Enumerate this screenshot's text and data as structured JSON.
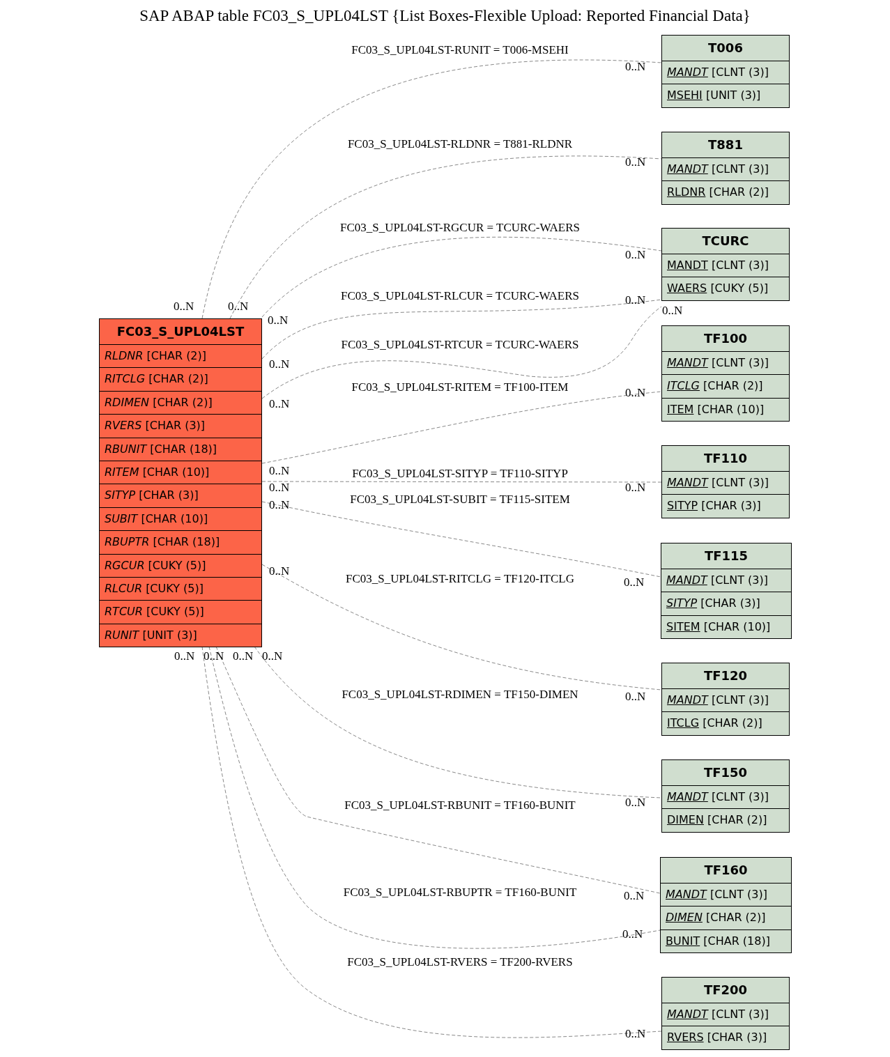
{
  "title": "SAP ABAP table FC03_S_UPL04LST {List Boxes-Flexible Upload: Reported Financial Data}",
  "entities": [
    {
      "name": "FC03_S_UPL04LST",
      "kind": "main",
      "fields": [
        {
          "name": "RLDNR",
          "type": "[CHAR (2)]",
          "italic": true,
          "underline": false
        },
        {
          "name": "RITCLG",
          "type": "[CHAR (2)]",
          "italic": true,
          "underline": false
        },
        {
          "name": "RDIMEN",
          "type": "[CHAR (2)]",
          "italic": true,
          "underline": false
        },
        {
          "name": "RVERS",
          "type": "[CHAR (3)]",
          "italic": true,
          "underline": false
        },
        {
          "name": "RBUNIT",
          "type": "[CHAR (18)]",
          "italic": true,
          "underline": false
        },
        {
          "name": "RITEM",
          "type": "[CHAR (10)]",
          "italic": true,
          "underline": false
        },
        {
          "name": "SITYP",
          "type": "[CHAR (3)]",
          "italic": true,
          "underline": false
        },
        {
          "name": "SUBIT",
          "type": "[CHAR (10)]",
          "italic": true,
          "underline": false
        },
        {
          "name": "RBUPTR",
          "type": "[CHAR (18)]",
          "italic": true,
          "underline": false
        },
        {
          "name": "RGCUR",
          "type": "[CUKY (5)]",
          "italic": true,
          "underline": false
        },
        {
          "name": "RLCUR",
          "type": "[CUKY (5)]",
          "italic": true,
          "underline": false
        },
        {
          "name": "RTCUR",
          "type": "[CUKY (5)]",
          "italic": true,
          "underline": false
        },
        {
          "name": "RUNIT",
          "type": "[UNIT (3)]",
          "italic": true,
          "underline": false
        }
      ]
    },
    {
      "name": "T006",
      "kind": "related",
      "fields": [
        {
          "name": "MANDT",
          "type": "[CLNT (3)]",
          "italic": true,
          "underline": true
        },
        {
          "name": "MSEHI",
          "type": "[UNIT (3)]",
          "italic": false,
          "underline": true
        }
      ]
    },
    {
      "name": "T881",
      "kind": "related",
      "fields": [
        {
          "name": "MANDT",
          "type": "[CLNT (3)]",
          "italic": true,
          "underline": true
        },
        {
          "name": "RLDNR",
          "type": "[CHAR (2)]",
          "italic": false,
          "underline": true
        }
      ]
    },
    {
      "name": "TCURC",
      "kind": "related",
      "fields": [
        {
          "name": "MANDT",
          "type": "[CLNT (3)]",
          "italic": false,
          "underline": true
        },
        {
          "name": "WAERS",
          "type": "[CUKY (5)]",
          "italic": false,
          "underline": true
        }
      ]
    },
    {
      "name": "TF100",
      "kind": "related",
      "fields": [
        {
          "name": "MANDT",
          "type": "[CLNT (3)]",
          "italic": true,
          "underline": true
        },
        {
          "name": "ITCLG",
          "type": "[CHAR (2)]",
          "italic": true,
          "underline": true
        },
        {
          "name": "ITEM",
          "type": "[CHAR (10)]",
          "italic": false,
          "underline": true
        }
      ]
    },
    {
      "name": "TF110",
      "kind": "related",
      "fields": [
        {
          "name": "MANDT",
          "type": "[CLNT (3)]",
          "italic": true,
          "underline": true
        },
        {
          "name": "SITYP",
          "type": "[CHAR (3)]",
          "italic": false,
          "underline": true
        }
      ]
    },
    {
      "name": "TF115",
      "kind": "related",
      "fields": [
        {
          "name": "MANDT",
          "type": "[CLNT (3)]",
          "italic": true,
          "underline": true
        },
        {
          "name": "SITYP",
          "type": "[CHAR (3)]",
          "italic": true,
          "underline": true
        },
        {
          "name": "SITEM",
          "type": "[CHAR (10)]",
          "italic": false,
          "underline": true
        }
      ]
    },
    {
      "name": "TF120",
      "kind": "related",
      "fields": [
        {
          "name": "MANDT",
          "type": "[CLNT (3)]",
          "italic": true,
          "underline": true
        },
        {
          "name": "ITCLG",
          "type": "[CHAR (2)]",
          "italic": false,
          "underline": true
        }
      ]
    },
    {
      "name": "TF150",
      "kind": "related",
      "fields": [
        {
          "name": "MANDT",
          "type": "[CLNT (3)]",
          "italic": true,
          "underline": true
        },
        {
          "name": "DIMEN",
          "type": "[CHAR (2)]",
          "italic": false,
          "underline": true
        }
      ]
    },
    {
      "name": "TF160",
      "kind": "related",
      "fields": [
        {
          "name": "MANDT",
          "type": "[CLNT (3)]",
          "italic": true,
          "underline": true
        },
        {
          "name": "DIMEN",
          "type": "[CHAR (2)]",
          "italic": true,
          "underline": true
        },
        {
          "name": "BUNIT",
          "type": "[CHAR (18)]",
          "italic": false,
          "underline": true
        }
      ]
    },
    {
      "name": "TF200",
      "kind": "related",
      "fields": [
        {
          "name": "MANDT",
          "type": "[CLNT (3)]",
          "italic": true,
          "underline": true
        },
        {
          "name": "RVERS",
          "type": "[CHAR (3)]",
          "italic": false,
          "underline": true
        }
      ]
    }
  ],
  "relations": [
    {
      "label": "FC03_S_UPL04LST-RUNIT = T006-MSEHI",
      "source_cardinality": "0..N",
      "target_cardinality": "0..N"
    },
    {
      "label": "FC03_S_UPL04LST-RLDNR = T881-RLDNR",
      "source_cardinality": "0..N",
      "target_cardinality": "0..N"
    },
    {
      "label": "FC03_S_UPL04LST-RGCUR = TCURC-WAERS",
      "source_cardinality": "0..N",
      "target_cardinality": "0..N"
    },
    {
      "label": "FC03_S_UPL04LST-RLCUR = TCURC-WAERS",
      "source_cardinality": "0..N",
      "target_cardinality": "0..N"
    },
    {
      "label": "FC03_S_UPL04LST-RTCUR = TCURC-WAERS",
      "source_cardinality": "0..N",
      "target_cardinality": "0..N"
    },
    {
      "label": "FC03_S_UPL04LST-RITEM = TF100-ITEM",
      "source_cardinality": "0..N",
      "target_cardinality": "0..N"
    },
    {
      "label": "FC03_S_UPL04LST-SITYP = TF110-SITYP",
      "source_cardinality": "0..N",
      "target_cardinality": "0..N"
    },
    {
      "label": "FC03_S_UPL04LST-SUBIT = TF115-SITEM",
      "source_cardinality": "0..N",
      "target_cardinality": "0..N"
    },
    {
      "label": "FC03_S_UPL04LST-RITCLG = TF120-ITCLG",
      "source_cardinality": "0..N",
      "target_cardinality": "0..N"
    },
    {
      "label": "FC03_S_UPL04LST-RDIMEN = TF150-DIMEN",
      "source_cardinality": "0..N",
      "target_cardinality": "0..N"
    },
    {
      "label": "FC03_S_UPL04LST-RBUNIT = TF160-BUNIT",
      "source_cardinality": "0..N",
      "target_cardinality": "0..N"
    },
    {
      "label": "FC03_S_UPL04LST-RBUPTR = TF160-BUNIT",
      "source_cardinality": "0..N",
      "target_cardinality": "0..N"
    },
    {
      "label": "FC03_S_UPL04LST-RVERS = TF200-RVERS",
      "source_cardinality": "0..N",
      "target_cardinality": "0..N"
    }
  ]
}
